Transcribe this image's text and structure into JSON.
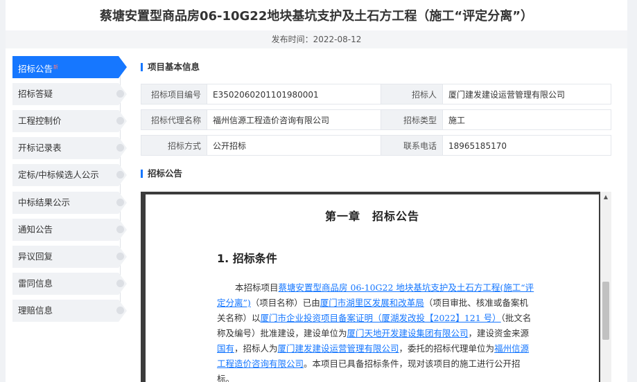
{
  "page": {
    "title": "蔡塘安置型商品房06-10G22地块基坑支护及土石方工程（施工“评定分离”）",
    "publish_time": "发布时间：2022-08-12"
  },
  "sidebar": {
    "items": [
      {
        "label": "招标公告",
        "active": true,
        "badge": "新"
      },
      {
        "label": "招标答疑"
      },
      {
        "label": "工程控制价"
      },
      {
        "label": "开标记录表"
      },
      {
        "label": "定标/中标候选人公示"
      },
      {
        "label": "中标结果公示"
      },
      {
        "label": "通知公告"
      },
      {
        "label": "异议回复"
      },
      {
        "label": "雷同信息"
      },
      {
        "label": "理赔信息"
      }
    ]
  },
  "sections": {
    "basic_info": "项目基本信息",
    "notice": "招标公告"
  },
  "info": {
    "rows": [
      {
        "l1": "招标项目编号",
        "v1": "E3502060201101980001",
        "l2": "招标人",
        "v2": "厦门建发建设运营管理有限公司"
      },
      {
        "l1": "招标代理名称",
        "v1": "福州信源工程造价咨询有限公司",
        "l2": "招标类型",
        "v2": "施工"
      },
      {
        "l1": "招标方式",
        "v1": "公开招标",
        "l2": "联系电话",
        "v2": "18965185170"
      }
    ]
  },
  "document": {
    "chapter": "第一章　招标公告",
    "heading": "1. 招标条件",
    "para": {
      "t1": "本招标项目",
      "u1": "蔡塘安置型商品房 06-10G22 地块基坑支护及土石方工程(施工“评定分离”)",
      "t2": "（项目名称）已由",
      "u2": "厦门市湖里区发展和改革局",
      "t3": "（项目审批、核准或备案机关名称）以",
      "u3": "厦门市企业投资项目备案证明（厦湖发改投【2022】121 号）",
      "t4": "（批文名称及编号）批准建设，建设单位为",
      "u4": "厦门天地开发建设集团有限公司",
      "t5": "，建设资金来源",
      "u5": "国有",
      "t6": "，招标人为",
      "u6": "厦门建发建设运营管理有限公司",
      "t7": "，委托的招标代理单位为",
      "u7": "福州信源工程造价咨询有限公司",
      "t8": "。本项目已具备招标条件，现对该项目的施工进行公开招标。"
    }
  },
  "colors": {
    "accent": "#1677ff",
    "badge": "#ff4d4f"
  }
}
